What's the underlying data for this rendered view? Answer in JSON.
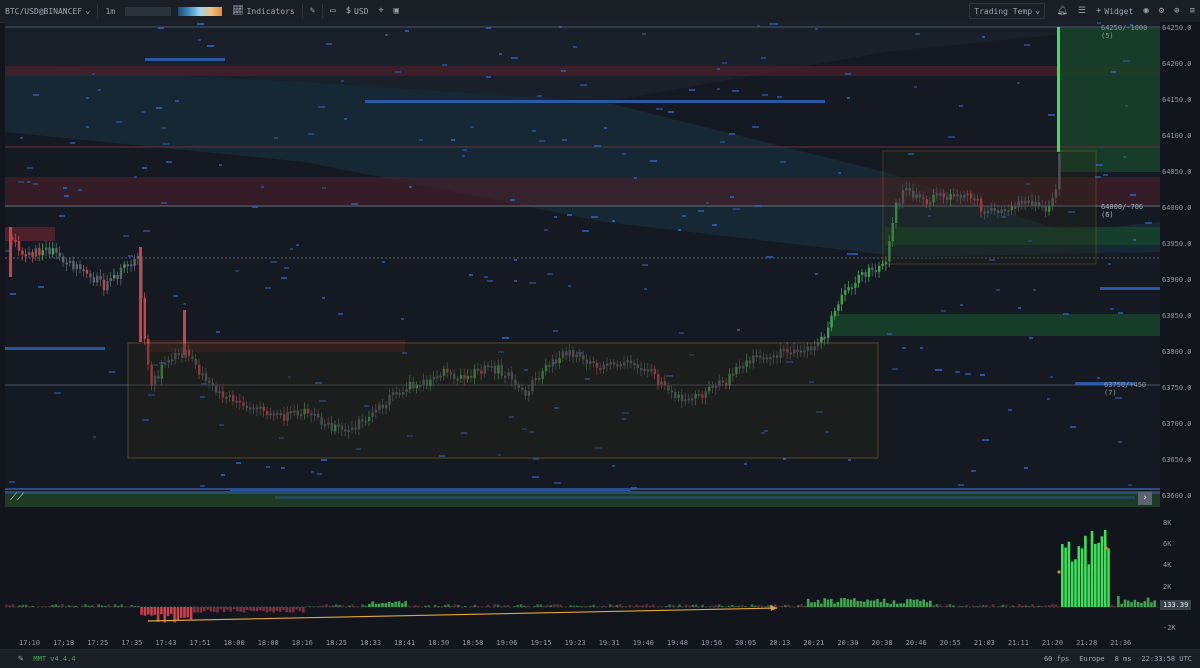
{
  "toolbar": {
    "symbol": "BTC/USD@BINANCEF",
    "timeframe": "1m",
    "indicators_label": "Indicators",
    "currency": "USD",
    "layout_label": "Trading Temp",
    "widget_label": "Widget"
  },
  "price_axis": {
    "ticks": [
      "64250.0",
      "64200.0",
      "64150.0",
      "64100.0",
      "64050.0",
      "64000.0",
      "63950.0",
      "63900.0",
      "63850.0",
      "63800.0",
      "63750.0",
      "63700.0",
      "63650.0",
      "63600.0"
    ]
  },
  "annotations": {
    "level_top": "64250/-1000 (5)",
    "level_mid": "64000/-706 (6)",
    "level_low": "63750/+450 (7)"
  },
  "volume_axis": {
    "ticks": [
      "8K",
      "6K",
      "4K",
      "2K",
      "-2K"
    ],
    "current_value": "133.39"
  },
  "time_axis": {
    "ticks": [
      "17:10",
      "17:18",
      "17:25",
      "17:35",
      "17:43",
      "17:51",
      "18:00",
      "18:08",
      "18:16",
      "18:25",
      "18:33",
      "18:41",
      "18:50",
      "18:58",
      "19:06",
      "19:15",
      "19:23",
      "19:31",
      "19:40",
      "19:48",
      "19:56",
      "20:05",
      "20:13",
      "20:21",
      "20:30",
      "20:38",
      "20:46",
      "20:55",
      "21:03",
      "21:11",
      "21:20",
      "21:28",
      "21:36"
    ]
  },
  "statusbar": {
    "version": "MMT v4.4.4",
    "fps": "60 fps",
    "region": "Europe",
    "latency": "8 ms",
    "clock": "22:33:58 UTC"
  },
  "colors": {
    "up": "#3fa34d",
    "down": "#c9414b",
    "neutral": "#5b636d",
    "box": "#c89b2e",
    "bright_green": "#3be05a"
  }
}
